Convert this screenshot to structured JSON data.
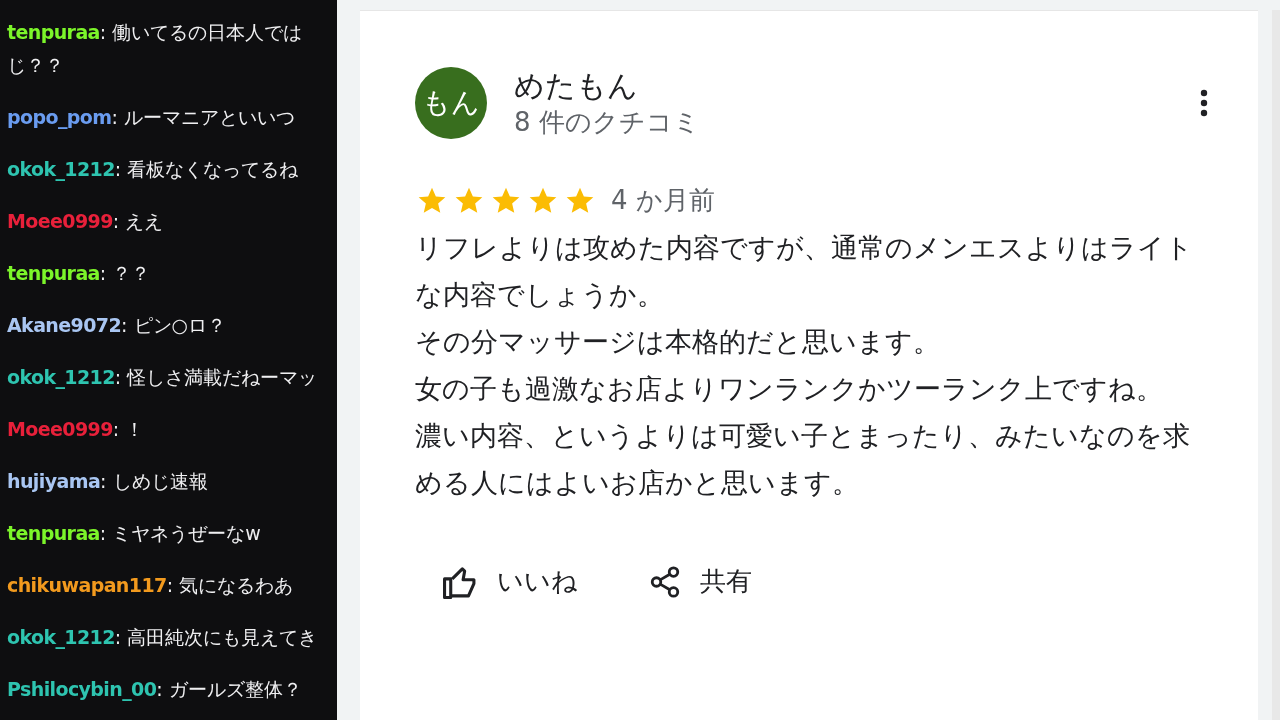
{
  "chat": [
    {
      "user": "tenpuraa",
      "color": "#7cf52a",
      "lines": [
        ": 働いてるの日本人では",
        "じ？？"
      ]
    },
    {
      "user": "popo_pom",
      "color": "#6a9cf0",
      "lines": [
        ": ルーマニアといいつ"
      ]
    },
    {
      "user": "okok_1212",
      "color": "#2ec4b0",
      "lines": [
        ": 看板なくなってるね"
      ]
    },
    {
      "user": "Moee0999",
      "color": "#e8203a",
      "lines": [
        ": ええ"
      ]
    },
    {
      "user": "tenpuraa",
      "color": "#7cf52a",
      "lines": [
        ": ？？"
      ]
    },
    {
      "user": "Akane9072",
      "color": "#a9c6f2",
      "lines": [
        ": ピン○ロ？"
      ]
    },
    {
      "user": "okok_1212",
      "color": "#2ec4b0",
      "lines": [
        ": 怪しさ満載だねーマッ"
      ]
    },
    {
      "user": "Moee0999",
      "color": "#e8203a",
      "lines": [
        ": ！"
      ]
    },
    {
      "user": "hujiyama",
      "color": "#a9c6f2",
      "lines": [
        ": しめじ速報"
      ]
    },
    {
      "user": "tenpuraa",
      "color": "#7cf52a",
      "lines": [
        ": ミヤネうぜーなw"
      ]
    },
    {
      "user": "chikuwapan117",
      "color": "#f29a1e",
      "lines": [
        ": 気になるわあ"
      ]
    },
    {
      "user": "okok_1212",
      "color": "#2ec4b0",
      "lines": [
        ": 高田純次にも見えてき"
      ]
    },
    {
      "user": "Pshilocybin_00",
      "color": "#2ec4b0",
      "lines": [
        ": ガールズ整体？"
      ]
    }
  ],
  "review": {
    "avatar": "もん",
    "name": "めたもん",
    "count": "8 件のクチコミ",
    "stars": 5,
    "time": "4 か月前",
    "paragraphs": [
      "リフレよりは攻めた内容ですが、通常のメンエスよりはライトな内容でしょうか。",
      "その分マッサージは本格的だと思います。",
      "女の子も過激なお店よりワンランクかツーランク上ですね。",
      "濃い内容、というよりは可愛い子とまったり、みたいなのを求める人にはよいお店かと思います。"
    ],
    "actions": [
      {
        "kind": "like",
        "label": "いいね"
      },
      {
        "kind": "share",
        "label": "共有"
      }
    ]
  }
}
